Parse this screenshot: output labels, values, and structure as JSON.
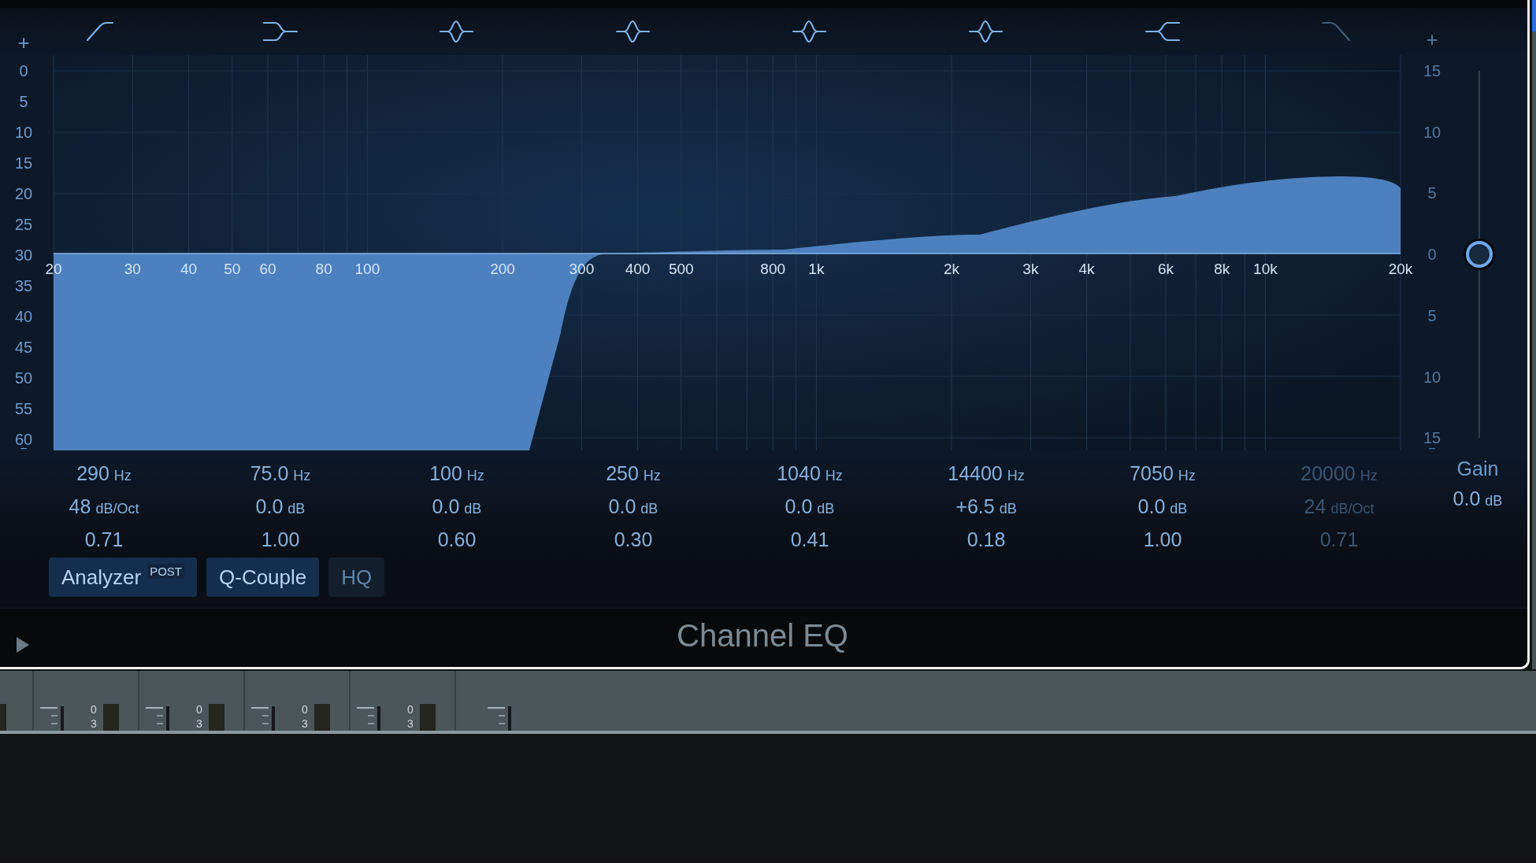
{
  "plugin": {
    "title": "Channel EQ",
    "bands": [
      {
        "kind": "lowcut",
        "enabled": true,
        "frequency": "290",
        "frequency_unit": "Hz",
        "gain": "48",
        "gain_unit": "dB/Oct",
        "q": "0.71"
      },
      {
        "kind": "lowshelf",
        "enabled": true,
        "frequency": "75.0",
        "frequency_unit": "Hz",
        "gain": "0.0",
        "gain_unit": "dB",
        "q": "1.00"
      },
      {
        "kind": "bell",
        "enabled": true,
        "frequency": "100",
        "frequency_unit": "Hz",
        "gain": "0.0",
        "gain_unit": "dB",
        "q": "0.60"
      },
      {
        "kind": "bell",
        "enabled": true,
        "frequency": "250",
        "frequency_unit": "Hz",
        "gain": "0.0",
        "gain_unit": "dB",
        "q": "0.30"
      },
      {
        "kind": "bell",
        "enabled": true,
        "frequency": "1040",
        "frequency_unit": "Hz",
        "gain": "0.0",
        "gain_unit": "dB",
        "q": "0.41"
      },
      {
        "kind": "bell",
        "enabled": true,
        "frequency": "14400",
        "frequency_unit": "Hz",
        "gain": "+6.5",
        "gain_unit": "dB",
        "q": "0.18"
      },
      {
        "kind": "highshelf",
        "enabled": true,
        "frequency": "7050",
        "frequency_unit": "Hz",
        "gain": "0.0",
        "gain_unit": "dB",
        "q": "1.00"
      },
      {
        "kind": "highcut",
        "enabled": false,
        "frequency": "20000",
        "frequency_unit": "Hz",
        "gain": "24",
        "gain_unit": "dB/Oct",
        "q": "0.71"
      }
    ],
    "analyzer_scale": {
      "top": "+",
      "labels": [
        "0",
        "5",
        "10",
        "15",
        "20",
        "25",
        "30",
        "35",
        "40",
        "45",
        "50",
        "55",
        "60"
      ],
      "bottom": "−"
    },
    "gain_scale": {
      "top": "+",
      "labels": [
        "15",
        "10",
        "5",
        "0",
        "5",
        "10",
        "15"
      ],
      "bottom": "−"
    },
    "frequency_labels": [
      "20",
      "30",
      "40",
      "50",
      "60",
      "80",
      "100",
      "200",
      "300",
      "400",
      "500",
      "800",
      "1k",
      "2k",
      "3k",
      "4k",
      "6k",
      "8k",
      "10k",
      "20k"
    ],
    "master_gain": {
      "label": "Gain",
      "value": "0.0",
      "unit": "dB",
      "level": 0.5
    },
    "buttons": [
      {
        "label": "Analyzer",
        "badge": "POST",
        "on": true
      },
      {
        "label": "Q-Couple",
        "on": true
      },
      {
        "label": "HQ",
        "on": false
      }
    ]
  },
  "mixer": {
    "strips": [
      {
        "kind": "meter",
        "scale": [
          "0",
          "3"
        ]
      },
      {
        "kind": "meter",
        "scale": [
          "0",
          "3"
        ]
      },
      {
        "kind": "meter",
        "scale": [
          "0",
          "3"
        ]
      },
      {
        "kind": "meter",
        "scale": [
          "0",
          "3"
        ]
      },
      {
        "kind": "fader"
      }
    ]
  }
}
